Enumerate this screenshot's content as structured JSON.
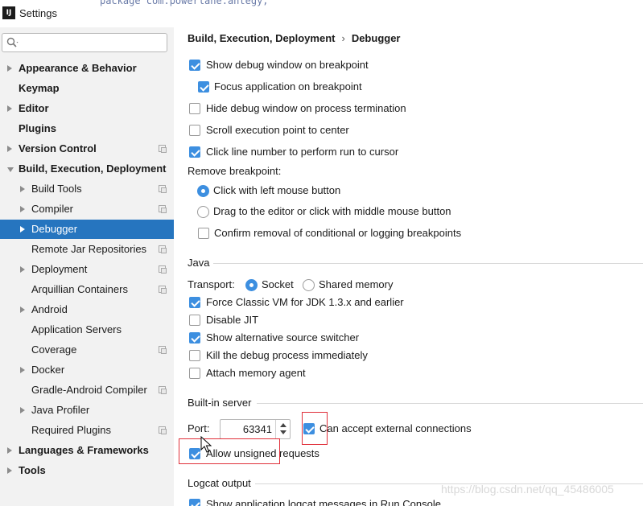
{
  "window": {
    "title": "Settings",
    "clipped_text": "package com.powerlane.antegy;"
  },
  "sidebar": {
    "items": [
      {
        "label": "Appearance & Behavior",
        "bold": true,
        "arrow": true
      },
      {
        "label": "Keymap",
        "bold": true,
        "arrow": false
      },
      {
        "label": "Editor",
        "bold": true,
        "arrow": true
      },
      {
        "label": "Plugins",
        "bold": true,
        "arrow": false
      },
      {
        "label": "Version Control",
        "bold": true,
        "arrow": true,
        "project_icon": true
      },
      {
        "label": "Build, Execution, Deployment",
        "bold": true,
        "arrow": true,
        "expanded": true
      },
      {
        "label": "Build Tools",
        "arrow": true,
        "project_icon": true
      },
      {
        "label": "Compiler",
        "arrow": true,
        "project_icon": true
      },
      {
        "label": "Debugger",
        "arrow": true,
        "selected": true
      },
      {
        "label": "Remote Jar Repositories",
        "arrow": false,
        "project_icon": true
      },
      {
        "label": "Deployment",
        "arrow": true,
        "project_icon": true
      },
      {
        "label": "Arquillian Containers",
        "arrow": false,
        "project_icon": true
      },
      {
        "label": "Android",
        "arrow": true
      },
      {
        "label": "Application Servers",
        "arrow": false
      },
      {
        "label": "Coverage",
        "arrow": false,
        "project_icon": true
      },
      {
        "label": "Docker",
        "arrow": true
      },
      {
        "label": "Gradle-Android Compiler",
        "arrow": false,
        "project_icon": true
      },
      {
        "label": "Java Profiler",
        "arrow": true
      },
      {
        "label": "Required Plugins",
        "arrow": false,
        "project_icon": true
      },
      {
        "label": "Languages & Frameworks",
        "bold": true,
        "arrow": true
      },
      {
        "label": "Tools",
        "bold": true,
        "arrow": true
      }
    ]
  },
  "breadcrumb": {
    "parent": "Build, Execution, Deployment",
    "separator": "›",
    "current": "Debugger"
  },
  "options": {
    "show_debug_window": {
      "label": "Show debug window on breakpoint",
      "checked": true
    },
    "focus_application": {
      "label": "Focus application on breakpoint",
      "checked": true
    },
    "hide_debug_window": {
      "label": "Hide debug window on process termination",
      "checked": false
    },
    "scroll_execution": {
      "label": "Scroll execution point to center",
      "checked": false
    },
    "click_line_number": {
      "label": "Click line number to perform run to cursor",
      "checked": true
    },
    "remove_breakpoint_label": "Remove breakpoint:",
    "remove_left_click": {
      "label": "Click with left mouse button",
      "selected": true
    },
    "remove_drag": {
      "label": "Drag to the editor or click with middle mouse button",
      "selected": false
    },
    "confirm_removal": {
      "label": "Confirm removal of conditional or logging breakpoints",
      "checked": false
    }
  },
  "java": {
    "section": "Java",
    "transport_label": "Transport:",
    "socket": {
      "label": "Socket",
      "selected": true
    },
    "shared_memory": {
      "label": "Shared memory",
      "selected": false
    },
    "force_classic_vm": {
      "label": "Force Classic VM for JDK 1.3.x and earlier",
      "checked": true
    },
    "disable_jit": {
      "label": "Disable JIT",
      "checked": false
    },
    "alt_source_switcher": {
      "label": "Show alternative source switcher",
      "checked": true
    },
    "kill_process": {
      "label": "Kill the debug process immediately",
      "checked": false
    },
    "attach_memory_agent": {
      "label": "Attach memory agent",
      "checked": false
    }
  },
  "builtin_server": {
    "section": "Built-in server",
    "port_label": "Port:",
    "port_value": "63341",
    "accept_external": {
      "label": "Can accept external connections",
      "checked": true
    },
    "allow_unsigned": {
      "label": "Allow unsigned requests",
      "checked": true
    }
  },
  "logcat": {
    "section": "Logcat output",
    "show_app_logcat": {
      "label": "Show application logcat messages in Run Console",
      "checked": true
    }
  },
  "watermark": "https://blog.csdn.net/qq_45486005",
  "colors": {
    "selection": "#2675bf",
    "checkbox_on": "#3d8fe0",
    "sidebar_bg": "#f2f2f2",
    "annotation_red": "#e0303a"
  }
}
